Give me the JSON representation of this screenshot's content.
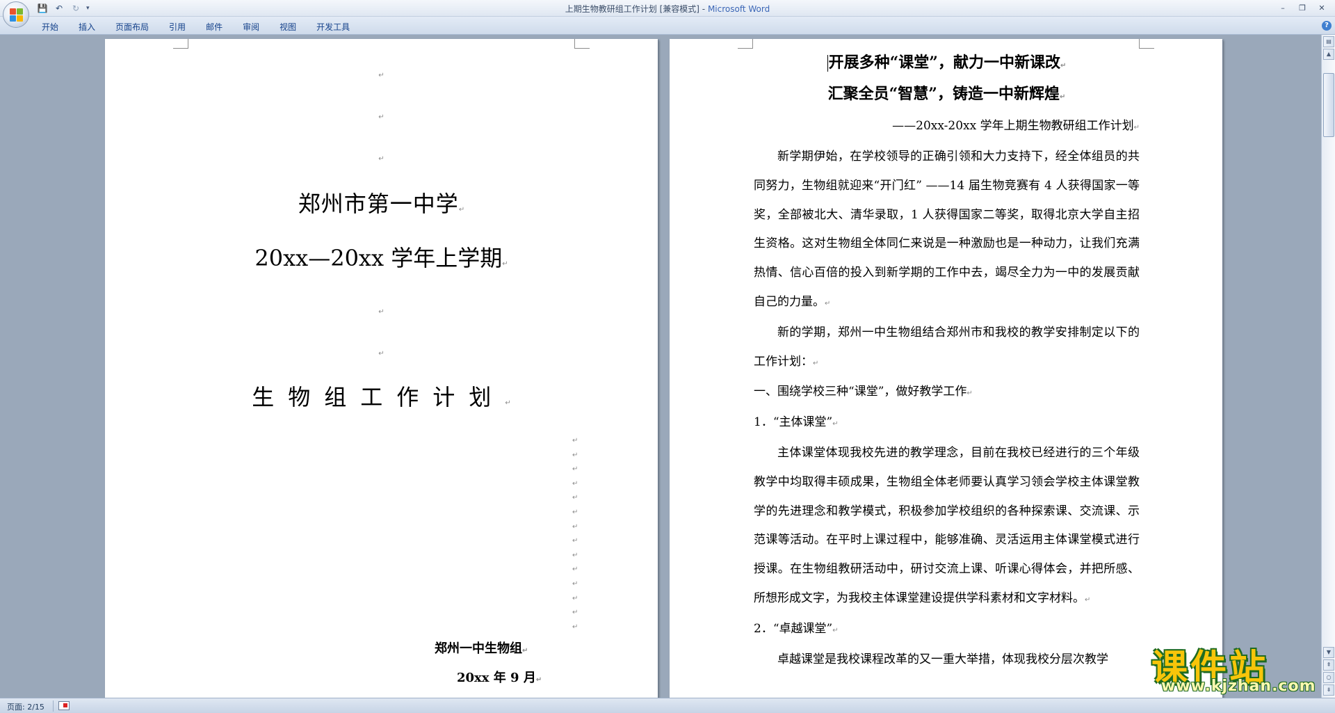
{
  "window": {
    "doc_title": "上期生物教研组工作计划",
    "mode": "[兼容模式]",
    "separator": " - ",
    "app_name": "Microsoft Word",
    "minimize": "–",
    "restore": "❐",
    "close": "✕"
  },
  "qat": {
    "save": "💾",
    "undo": "↶",
    "redo": "↻",
    "more": "▾"
  },
  "ribbon_tabs": [
    "开始",
    "插入",
    "页面布局",
    "引用",
    "邮件",
    "审阅",
    "视图",
    "开发工具"
  ],
  "help": "?",
  "marks": {
    "para": "↵"
  },
  "left_page": {
    "school": "郑州市第一中学",
    "year": "20xx—20xx 学年上学期",
    "plan_title": "生物组工作计划",
    "group": "郑州一中生物组",
    "date": "20xx 年 9 月"
  },
  "right_page": {
    "heading1": "开展多种“课堂”，献力一中新课改",
    "heading2": "汇聚全员“智慧”，铸造一中新辉煌",
    "subtitle": "——20xx-20xx 学年上期生物教研组工作计划",
    "p1": "新学期伊始，在学校领导的正确引领和大力支持下，经全体组员的共同努力，生物组就迎来“开门红” ——14 届生物竞赛有 4 人获得国家一等奖，全部被北大、清华录取，1 人获得国家二等奖，取得北京大学自主招生资格。这对生物组全体同仁来说是一种激励也是一种动力，让我们充满热情、信心百倍的投入到新学期的工作中去，竭尽全力为一中的发展贡献自己的力量。",
    "p2": "新的学期，郑州一中生物组结合郑州市和我校的教学安排制定以下的工作计划：",
    "s1": "一、围绕学校三种“课堂”，做好教学工作",
    "s1_1": "1．“主体课堂”",
    "p3": "主体课堂体现我校先进的教学理念，目前在我校已经进行的三个年级教学中均取得丰硕成果，生物组全体老师要认真学习领会学校主体课堂教学的先进理念和教学模式，积极参加学校组织的各种探索课、交流课、示范课等活动。在平时上课过程中，能够准确、灵活运用主体课堂模式进行授课。在生物组教研活动中，研讨交流上课、听课心得体会，并把所感、所想形成文字，为我校主体课堂建设提供学科素材和文字材料。",
    "s1_2": "2．“卓越课堂”",
    "p4": "卓越课堂是我校课程改革的又一重大举措，体现我校分层次教学"
  },
  "status": {
    "page": "页面: 2/15"
  },
  "watermark": {
    "title": "课件站",
    "url": "www.kjzhan.com"
  },
  "colors": {
    "background": "#9aa8ba",
    "tab_text": "#15428b",
    "app_name": "#3b66b6",
    "watermark_yellow": "#f7c50a",
    "watermark_green": "#1f6b22"
  }
}
